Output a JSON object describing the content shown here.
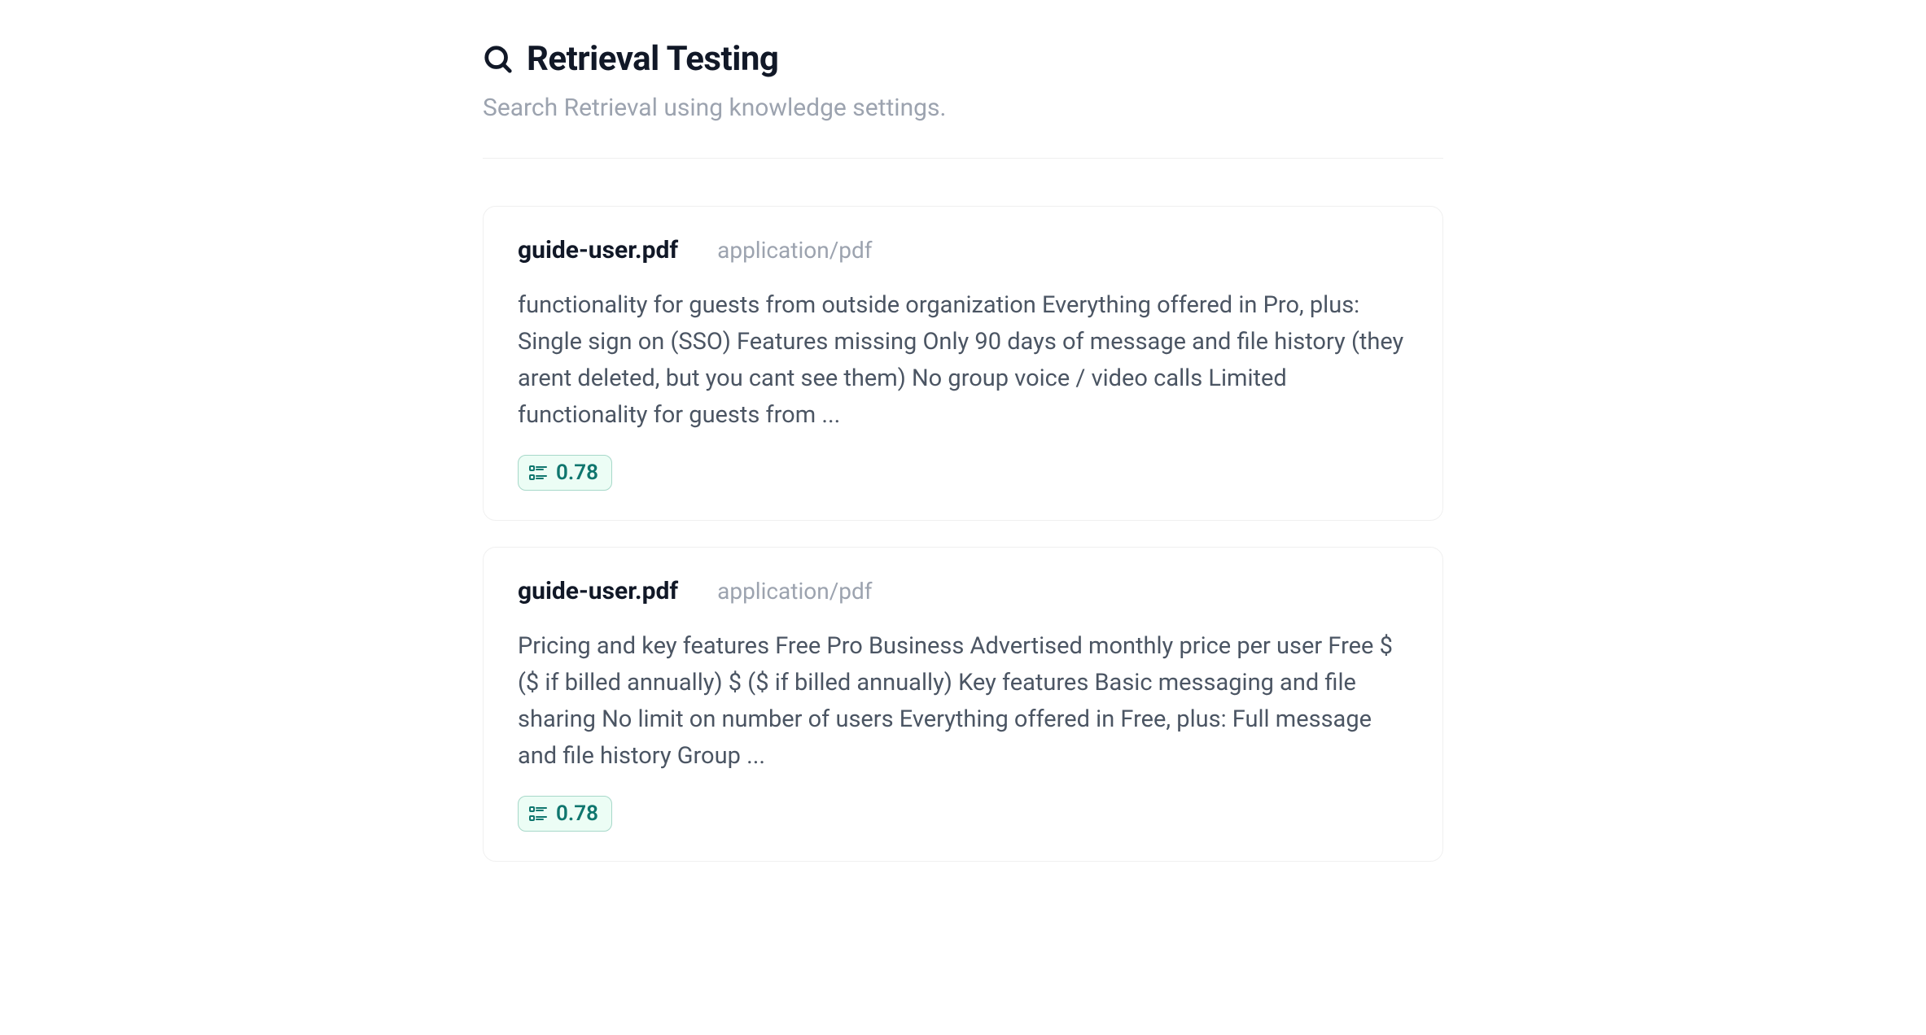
{
  "header": {
    "title": "Retrieval Testing",
    "subtitle": "Search Retrieval using knowledge settings."
  },
  "results": [
    {
      "filename": "guide-user.pdf",
      "mimetype": "application/pdf",
      "content": " functionality for guests from outside organization Everything offered in Pro, plus: Single sign on (SSO) Features missing Only 90 days of message and file history (they arent deleted, but you cant see them) No group voice / video calls Limited functionality for guests from ...",
      "score": "0.78"
    },
    {
      "filename": "guide-user.pdf",
      "mimetype": "application/pdf",
      "content": " Pricing and key features Free Pro Business Advertised monthly price per user Free $ ($ if billed annually) $ ($ if billed annually) Key features Basic messaging and file sharing No limit on number of users Everything offered in Free, plus: Full message and file history Group ...",
      "score": "0.78"
    }
  ]
}
